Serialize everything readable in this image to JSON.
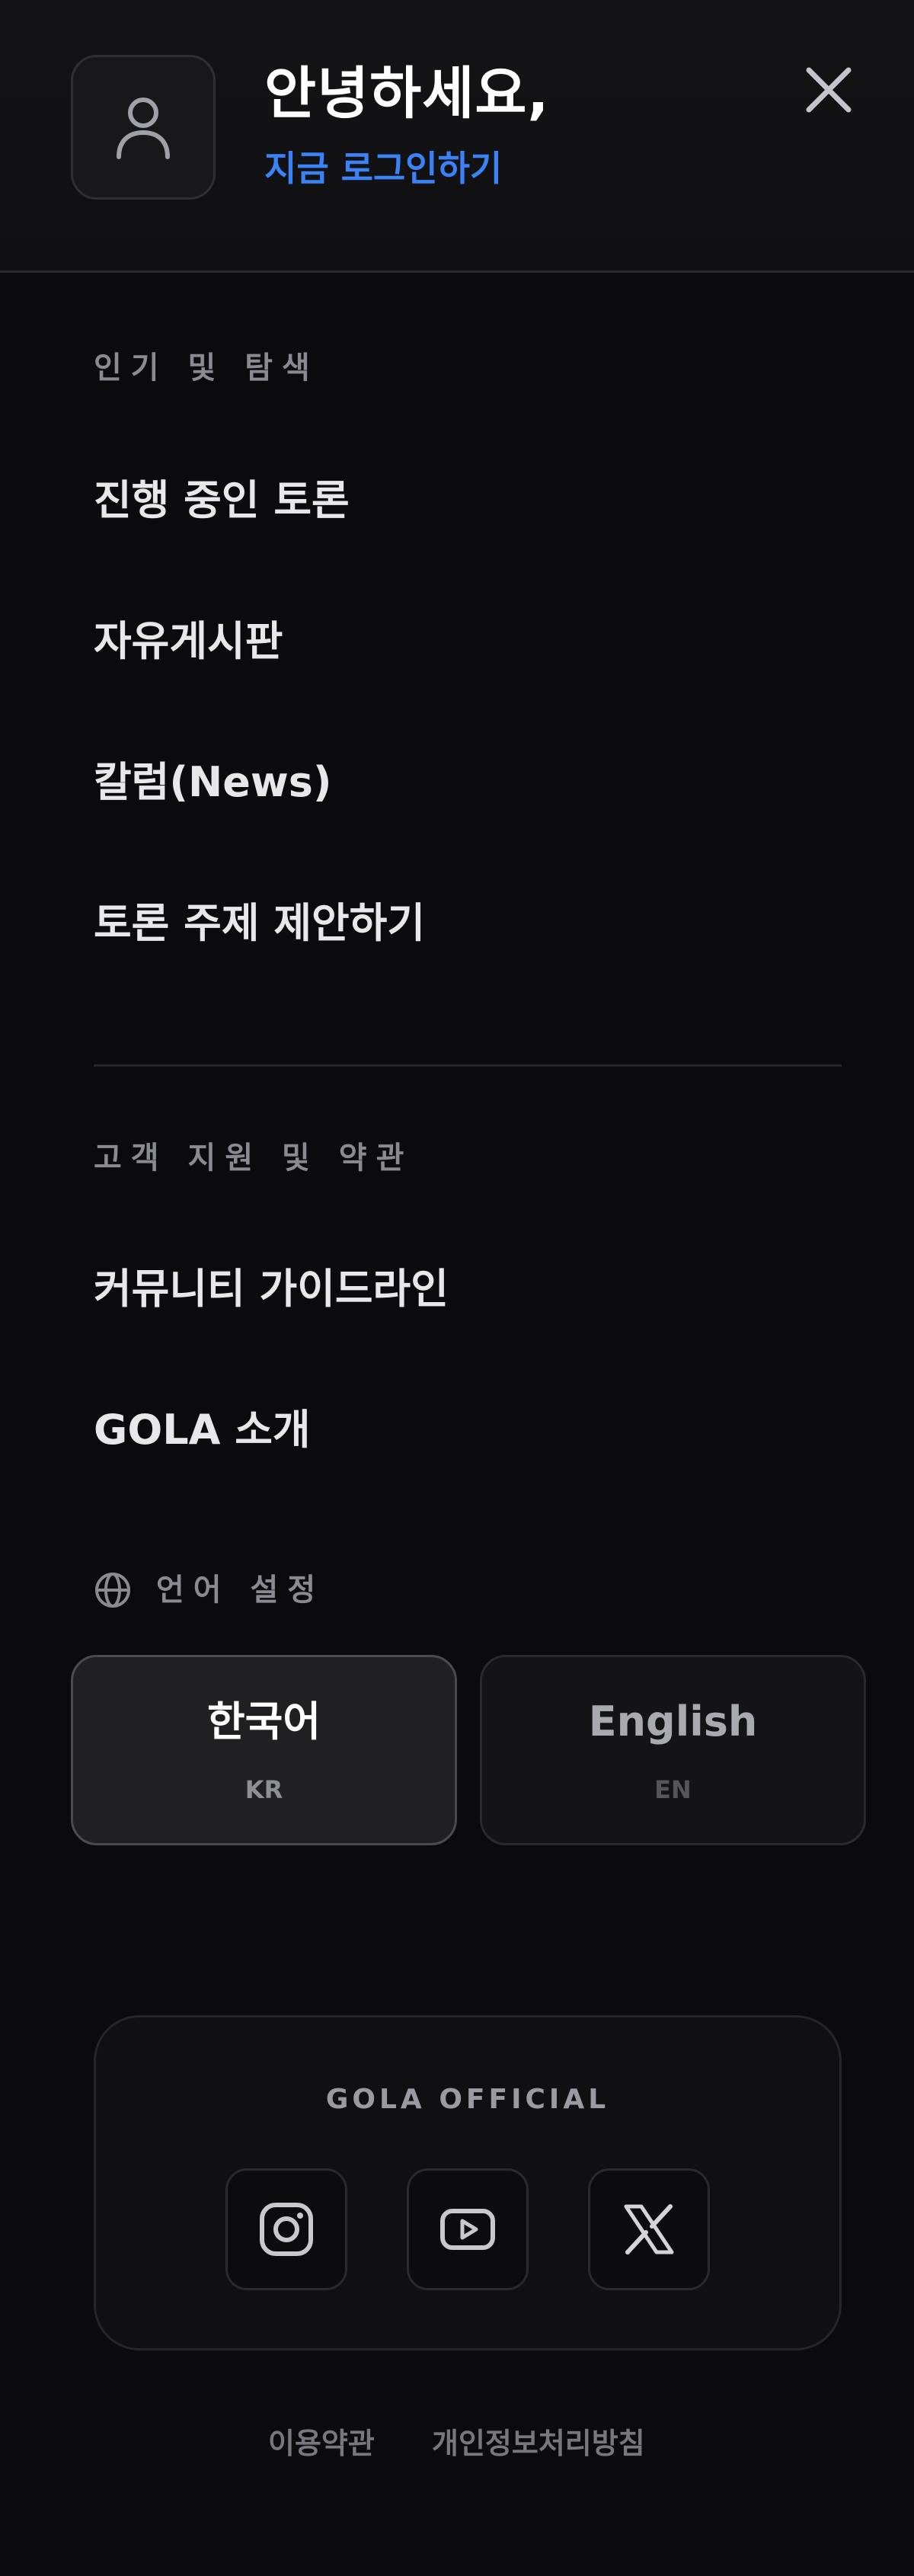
{
  "header": {
    "greeting": "안녕하세요,",
    "login_link": "지금 로그인하기"
  },
  "sections": {
    "popular": {
      "title": "인기 및 탐색",
      "items": [
        {
          "label": "진행 중인 토론"
        },
        {
          "label": "자유게시판"
        },
        {
          "label": "칼럼(News)"
        },
        {
          "label": "토론 주제 제안하기"
        }
      ]
    },
    "support": {
      "title": "고객 지원 및 약관",
      "items": [
        {
          "label": "커뮤니티 가이드라인"
        },
        {
          "label": "GOLA 소개"
        }
      ]
    }
  },
  "language": {
    "label": "언어 설정",
    "options": [
      {
        "name": "한국어",
        "code": "KR",
        "selected": true
      },
      {
        "name": "English",
        "code": "EN",
        "selected": false
      }
    ]
  },
  "official": {
    "title": "GOLA OFFICIAL",
    "social": [
      {
        "icon": "instagram-icon"
      },
      {
        "icon": "youtube-icon"
      },
      {
        "icon": "x-icon"
      }
    ]
  },
  "footer": {
    "terms": "이용약관",
    "privacy": "개인정보처리방침"
  },
  "colors": {
    "background": "#0b0b0d",
    "accent": "#3b82f6"
  }
}
